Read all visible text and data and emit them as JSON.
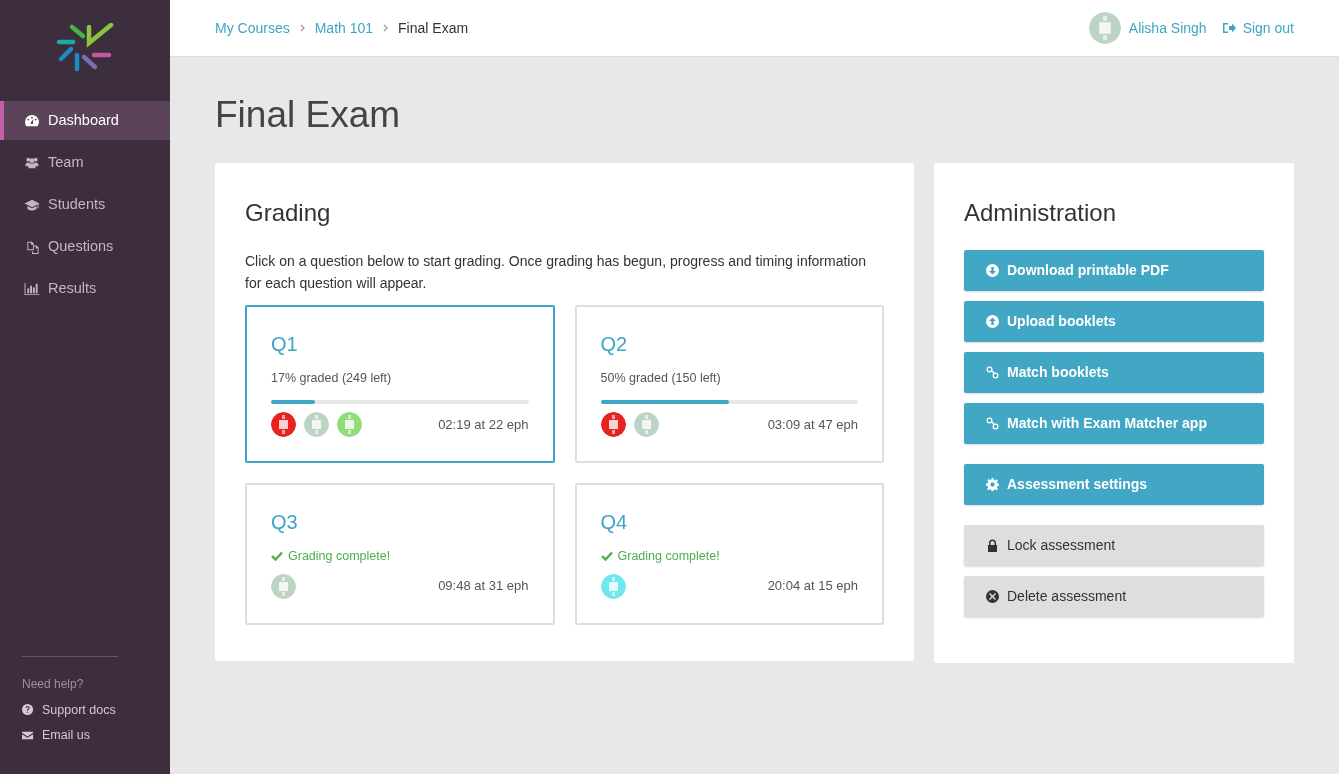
{
  "sidebar": {
    "items": [
      {
        "label": "Dashboard",
        "selected": true
      },
      {
        "label": "Team",
        "selected": false
      },
      {
        "label": "Students",
        "selected": false
      },
      {
        "label": "Questions",
        "selected": false
      },
      {
        "label": "Results",
        "selected": false
      }
    ],
    "help": {
      "heading": "Need help?",
      "links": [
        {
          "label": "Support docs"
        },
        {
          "label": "Email us"
        }
      ]
    }
  },
  "breadcrumb": [
    {
      "label": "My Courses",
      "current": false
    },
    {
      "label": "Math 101",
      "current": false
    },
    {
      "label": "Final Exam",
      "current": true
    }
  ],
  "user": {
    "name": "Alisha Singh",
    "sign_out": "Sign out"
  },
  "page_title": "Final Exam",
  "grading": {
    "title": "Grading",
    "intro": "Click on a question below to start grading. Once grading has begun, progress and timing information for each question will appear.",
    "questions": [
      {
        "title": "Q1",
        "kind": "progress",
        "selected": true,
        "status": "17% graded (249 left)",
        "level": 0.17,
        "graders": [
          {
            "color": "#e8221e"
          },
          {
            "color": "#bcd4c4"
          },
          {
            "color": "#8fdc7a"
          }
        ],
        "timing": "02:19 at 22 eph"
      },
      {
        "title": "Q2",
        "kind": "progress",
        "selected": false,
        "status": "50% graded (150 left)",
        "level": 0.5,
        "graders": [
          {
            "color": "#e8221e"
          },
          {
            "color": "#bcd4c4"
          }
        ],
        "timing": "03:09 at 47 eph"
      },
      {
        "title": "Q3",
        "kind": "complete",
        "selected": false,
        "status": "Grading complete!",
        "graders": [
          {
            "color": "#bcd4c4"
          }
        ],
        "timing": "09:48 at 31 eph"
      },
      {
        "title": "Q4",
        "kind": "complete",
        "selected": false,
        "status": "Grading complete!",
        "graders": [
          {
            "color": "#6ee8ec"
          }
        ],
        "timing": "20:04 at 15 eph"
      }
    ]
  },
  "administration": {
    "title": "Administration",
    "button_groups": [
      [
        {
          "label": "Download printable PDF",
          "kind": "primary"
        },
        {
          "label": "Upload booklets",
          "kind": "primary"
        },
        {
          "label": "Match booklets",
          "kind": "primary"
        },
        {
          "label": "Match with Exam Matcher app",
          "kind": "primary"
        }
      ],
      [
        {
          "label": "Assessment settings",
          "kind": "primary"
        }
      ],
      [
        {
          "label": "Lock assessment",
          "kind": "secondary"
        },
        {
          "label": "Delete assessment",
          "kind": "secondary"
        }
      ]
    ]
  }
}
